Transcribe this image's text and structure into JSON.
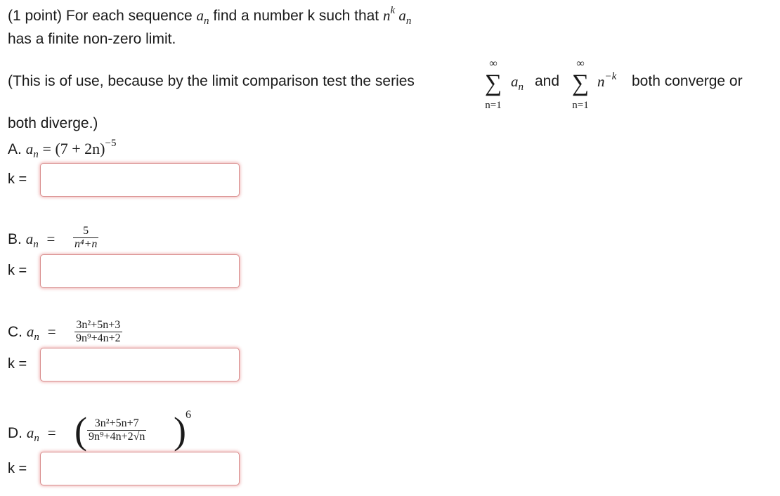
{
  "problem": {
    "intro_line1": "(1 point) For each sequence",
    "intro_line1b": "find a number k such that",
    "intro_line2": "has a finite non-zero limit.",
    "note_start": "(This is of use, because by the limit comparison test the series",
    "note_and": "and",
    "note_end": "both converge or",
    "note_line2": "both diverge.)",
    "sum_upper": "∞",
    "sum_symbol": "∑",
    "sum_lower": "n=1",
    "var_a": "a",
    "var_n": "n",
    "exp_k": "k",
    "exp_neg_k": "−k"
  },
  "parts": [
    {
      "label": "A.",
      "expr_main": "= (7 + 2n)",
      "expr_exp": "−5",
      "k_label": "k =",
      "answer_value": ""
    },
    {
      "label": "B.",
      "eq": "=",
      "numerator": "5",
      "denominator": "n⁴+n",
      "k_label": "k =",
      "answer_value": ""
    },
    {
      "label": "C.",
      "eq": "=",
      "numerator": "3n²+5n+3",
      "denominator": "9n⁹+4n+2",
      "k_label": "k =",
      "answer_value": ""
    },
    {
      "label": "D.",
      "eq": "=",
      "numerator": "3n²+5n+7",
      "denominator": "9n⁹+4n+2√n",
      "outer_exp": "6",
      "k_label": "k =",
      "answer_value": ""
    }
  ],
  "colors": {
    "input_border": "#d98e8e",
    "input_glow": "#dc5a5a",
    "text": "#1a1a1a"
  }
}
